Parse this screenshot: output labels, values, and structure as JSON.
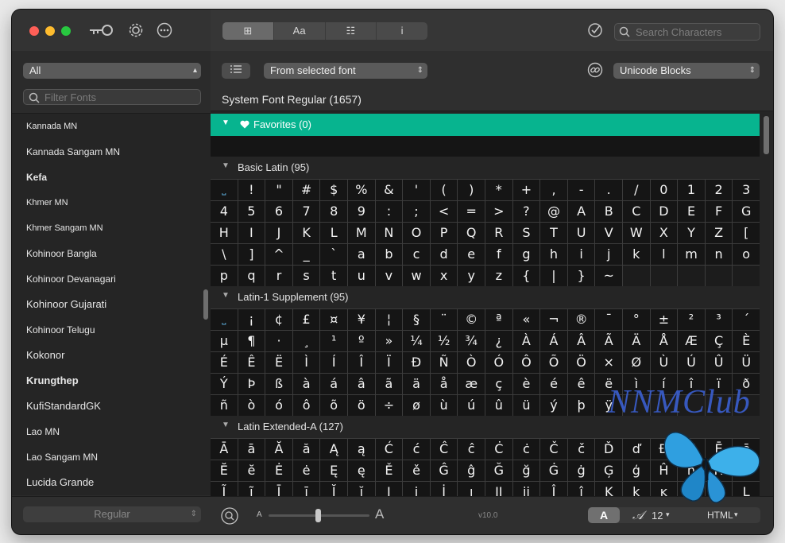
{
  "tabs": [
    {
      "label": "⊞",
      "name": "tab-grid"
    },
    {
      "label": "Aa",
      "name": "tab-font-preview"
    },
    {
      "label": "☷",
      "name": "tab-text"
    },
    {
      "label": "i",
      "name": "tab-info"
    }
  ],
  "search": {
    "placeholder": "Search Characters"
  },
  "sidebar": {
    "collection": "All",
    "filter_placeholder": "Filter Fonts",
    "fonts": [
      "Kannada MN",
      "Kannada Sangam MN",
      "Kefa",
      "Khmer MN",
      "Khmer Sangam MN",
      "Kohinoor Bangla",
      "Kohinoor Devanagari",
      "Kohinoor Gujarati",
      "Kohinoor Telugu",
      "Kokonor",
      "Krungthep",
      "KufiStandardGK",
      "Lao MN",
      "Lao Sangam MN",
      "Lucida Grande"
    ],
    "style": "Regular"
  },
  "toolbar": {
    "source": "From selected font",
    "blocks": "Unicode Blocks"
  },
  "font_title": "System Font Regular (1657)",
  "sections": {
    "favorites": "Favorites (0)",
    "basic_latin": "Basic Latin (95)",
    "latin1": "Latin-1 Supplement (95)",
    "latin_ext_a": "Latin Extended-A (127)"
  },
  "grids": {
    "basic_latin": [
      "⎵",
      "!",
      "\"",
      "#",
      "$",
      "%",
      "&",
      "'",
      "(",
      ")",
      "*",
      "+",
      ",",
      "-",
      ".",
      "/",
      "0",
      "1",
      "2",
      "3",
      "4",
      "5",
      "6",
      "7",
      "8",
      "9",
      ":",
      ";",
      "<",
      "=",
      ">",
      "?",
      "@",
      "A",
      "B",
      "C",
      "D",
      "E",
      "F",
      "G",
      "H",
      "I",
      "J",
      "K",
      "L",
      "M",
      "N",
      "O",
      "P",
      "Q",
      "R",
      "S",
      "T",
      "U",
      "V",
      "W",
      "X",
      "Y",
      "Z",
      "[",
      "\\",
      "]",
      "^",
      "_",
      "`",
      "a",
      "b",
      "c",
      "d",
      "e",
      "f",
      "g",
      "h",
      "i",
      "j",
      "k",
      "l",
      "m",
      "n",
      "o",
      "p",
      "q",
      "r",
      "s",
      "t",
      "u",
      "v",
      "w",
      "x",
      "y",
      "z",
      "{",
      "|",
      "}",
      "~"
    ],
    "latin1": [
      "⎵",
      "¡",
      "¢",
      "£",
      "¤",
      "¥",
      "¦",
      "§",
      "¨",
      "©",
      "ª",
      "«",
      "¬",
      "®",
      "¯",
      "°",
      "±",
      "²",
      "³",
      "´",
      "µ",
      "¶",
      "·",
      "¸",
      "¹",
      "º",
      "»",
      "¼",
      "½",
      "¾",
      "¿",
      "À",
      "Á",
      "Â",
      "Ã",
      "Ä",
      "Å",
      "Æ",
      "Ç",
      "È",
      "É",
      "Ê",
      "Ë",
      "Ì",
      "Í",
      "Î",
      "Ï",
      "Ð",
      "Ñ",
      "Ò",
      "Ó",
      "Ô",
      "Õ",
      "Ö",
      "×",
      "Ø",
      "Ù",
      "Ú",
      "Û",
      "Ü",
      "Ý",
      "Þ",
      "ß",
      "à",
      "á",
      "â",
      "ã",
      "ä",
      "å",
      "æ",
      "ç",
      "è",
      "é",
      "ê",
      "ë",
      "ì",
      "í",
      "î",
      "ï",
      "ð",
      "ñ",
      "ò",
      "ó",
      "ô",
      "õ",
      "ö",
      "÷",
      "ø",
      "ù",
      "ú",
      "û",
      "ü",
      "ý",
      "þ",
      "ÿ"
    ],
    "latin_ext_a": [
      "Ā",
      "ā",
      "Ă",
      "ă",
      "Ą",
      "ą",
      "Ć",
      "ć",
      "Ĉ",
      "ĉ",
      "Ċ",
      "ċ",
      "Č",
      "č",
      "Ď",
      "ď",
      "Đ",
      "đ",
      "Ē",
      "ē",
      "Ĕ",
      "ĕ",
      "Ė",
      "ė",
      "Ę",
      "ę",
      "Ě",
      "ě",
      "Ĝ",
      "ĝ",
      "Ğ",
      "ğ",
      "Ġ",
      "ġ",
      "Ģ",
      "ģ",
      "Ĥ",
      "ĥ",
      "Ħ",
      "ħ",
      "Ĩ",
      "ĩ",
      "Ī",
      "ī",
      "Ĭ",
      "ĭ",
      "Į",
      "į",
      "İ",
      "ı",
      "Ĳ",
      "ĳ",
      "Ĵ",
      "ĵ",
      "Ķ",
      "ķ",
      "ĸ",
      "Ĺ",
      "ĺ",
      "Ļ"
    ]
  },
  "status": {
    "small_a": "A",
    "large_a": "A",
    "version": "v10.0",
    "style_a": "A",
    "size": "12",
    "format": "HTML"
  },
  "watermark": "NNMClub",
  "colors": {
    "favorites_bar": "#07b48f",
    "close": "#fe5f57",
    "minimize": "#febc2e",
    "zoom": "#28c840"
  },
  "icons": [
    "key-icon",
    "gear-icon",
    "more-icon",
    "checkmark-icon",
    "search-icon",
    "list-icon",
    "link-icon",
    "zoom-icon",
    "heart-icon"
  ]
}
